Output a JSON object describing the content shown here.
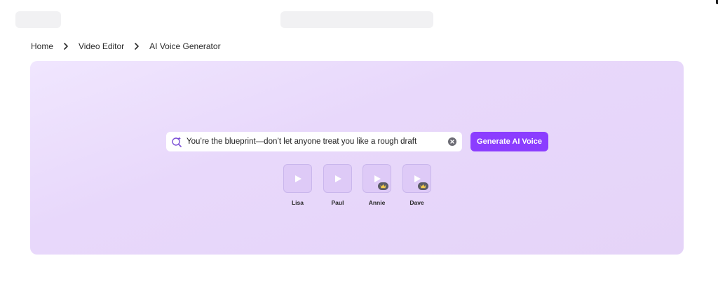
{
  "breadcrumb": {
    "items": [
      "Home",
      "Video Editor",
      "AI Voice Generator"
    ]
  },
  "generator": {
    "prompt_value": "You’re the blueprint—don’t let anyone treat you like a rough draft",
    "generate_label": "Generate AI Voice",
    "accent_color": "#8b3dff"
  },
  "voices": [
    {
      "name": "Lisa",
      "premium": false
    },
    {
      "name": "Paul",
      "premium": false
    },
    {
      "name": "Annie",
      "premium": true
    },
    {
      "name": "Dave",
      "premium": true
    }
  ],
  "icons": {
    "prompt": "sparkle-search-icon",
    "clear": "clear-icon",
    "play": "play-icon",
    "premium": "crown-icon",
    "separator": "chevron-right-icon"
  }
}
